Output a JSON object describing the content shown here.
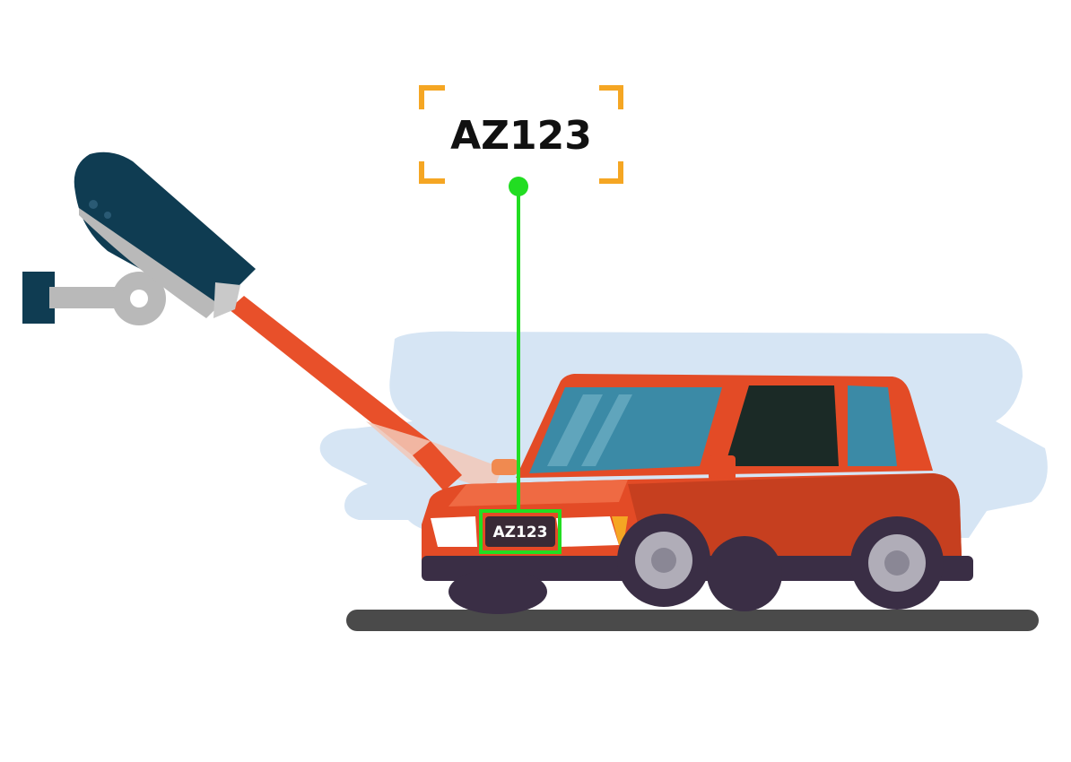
{
  "recognized_plate": {
    "text": "AZ123"
  },
  "car_plate": {
    "text": "AZ123"
  },
  "colors": {
    "camera_body": "#0f3c52",
    "camera_mount": "#b9b9b9",
    "beam": "#e8502a",
    "car_body": "#e34b26",
    "car_body_shadow": "#c63f1f",
    "window": "#3b8aa6",
    "window_dark": "#1b2a26",
    "tyre": "#3a2e45",
    "road": "#4a4a4a",
    "cloud": "#d6e5f4",
    "detection_green": "#22dd22",
    "bracket_orange": "#f5a623"
  },
  "icons": [
    "cctv-camera-icon",
    "car-icon"
  ]
}
